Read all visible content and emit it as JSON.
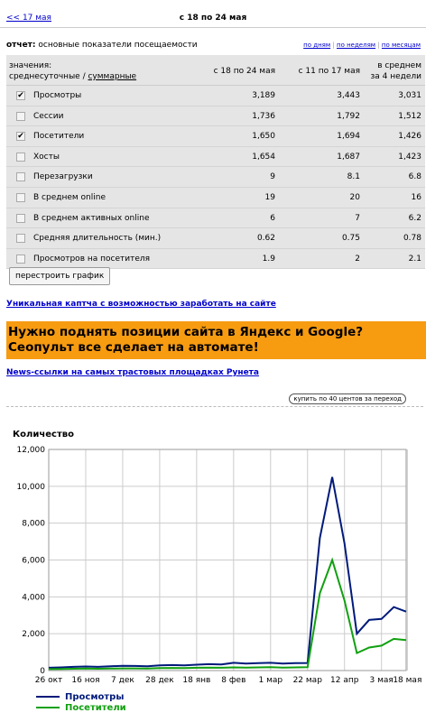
{
  "nav": {
    "prev_label": "<< 17 мая",
    "period_title": "с 18 по 24 мая"
  },
  "report": {
    "label_prefix": "отчет:",
    "label": "основные показатели посещаемости",
    "switch": [
      "по дням",
      "по неделям",
      "по месяцам"
    ],
    "separator": "|"
  },
  "table": {
    "values_line1": "значения:",
    "mode_daily": "среднесуточные",
    "mode_sep": " / ",
    "mode_total": "суммарные",
    "col1": "с 18 по 24 мая",
    "col2": "с 11 по 17 мая",
    "col3_l1": "в среднем",
    "col3_l2": "за 4 недели",
    "rows": [
      {
        "label": "Просмотры",
        "checked": true,
        "v1": "3,189",
        "v2": "3,443",
        "v3": "3,031"
      },
      {
        "label": "Сессии",
        "checked": false,
        "v1": "1,736",
        "v2": "1,792",
        "v3": "1,512"
      },
      {
        "label": "Посетители",
        "checked": true,
        "v1": "1,650",
        "v2": "1,694",
        "v3": "1,426"
      },
      {
        "label": "Хосты",
        "checked": false,
        "v1": "1,654",
        "v2": "1,687",
        "v3": "1,423"
      },
      {
        "label": "Перезагрузки",
        "checked": false,
        "v1": "9",
        "v2": "8.1",
        "v3": "6.8"
      },
      {
        "label": "В среднем online",
        "checked": false,
        "v1": "19",
        "v2": "20",
        "v3": "16"
      },
      {
        "label": "В среднем активных online",
        "checked": false,
        "v1": "6",
        "v2": "7",
        "v3": "6.2"
      },
      {
        "label": "Средняя длительность (мин.)",
        "checked": false,
        "v1": "0.62",
        "v2": "0.75",
        "v3": "0.78"
      },
      {
        "label": "Просмотров на посетителя",
        "checked": false,
        "v1": "1.9",
        "v2": "2",
        "v3": "2.1"
      }
    ],
    "rebuild_label": "перестроить график"
  },
  "ads": {
    "captcha_link": "Уникальная каптча с возможностью заработать на сайте",
    "banner_line1": "Нужно поднять позиции сайта в Яндекс и Google?",
    "banner_line2": "Сеопульт все сделает на автомате!",
    "news_link": "News-ссылки на самых трастовых площадках Рунета",
    "buy_button": "купить по 40 центов за переход"
  },
  "colors": {
    "banner": "#f79b11",
    "series_views": "#001a7a",
    "series_visitors": "#10a010",
    "link": "#0000cc"
  },
  "chart_data": {
    "type": "line",
    "ylabel": "Количество",
    "ylim": [
      0,
      12000
    ],
    "yticks": [
      "0",
      "2,000",
      "4,000",
      "6,000",
      "8,000",
      "10,000",
      "12,000"
    ],
    "ytick_values": [
      0,
      2000,
      4000,
      6000,
      8000,
      10000,
      12000
    ],
    "xticks": [
      "26 окт",
      "16 ноя",
      "7 дек",
      "28 дек",
      "18 янв",
      "8 фев",
      "1 мар",
      "22 мар",
      "12 апр",
      "3 мая",
      "18 мая"
    ],
    "xtick_index": [
      0,
      3,
      6,
      9,
      12,
      15,
      18,
      21,
      24,
      27,
      29.1
    ],
    "grid": true,
    "legend_position": "bottom-left",
    "series": [
      {
        "name": "Просмотры",
        "values": [
          150,
          170,
          200,
          220,
          200,
          230,
          260,
          250,
          230,
          280,
          300,
          280,
          320,
          350,
          330,
          420,
          380,
          400,
          420,
          380,
          400,
          410,
          7200,
          10500,
          6900,
          2000,
          2750,
          2800,
          3450,
          3200
        ]
      },
      {
        "name": "Посетители",
        "values": [
          80,
          90,
          100,
          110,
          100,
          110,
          120,
          120,
          110,
          130,
          140,
          130,
          150,
          160,
          150,
          170,
          160,
          170,
          180,
          160,
          170,
          180,
          4200,
          6000,
          3800,
          950,
          1250,
          1350,
          1720,
          1650
        ]
      }
    ]
  }
}
